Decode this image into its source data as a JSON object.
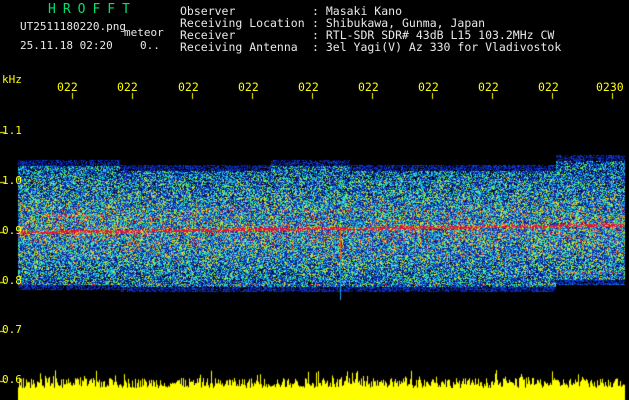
{
  "header": {
    "app_title": "HROFFT",
    "filename": "UT2511180220.png",
    "meteor_label": "meteor",
    "datetime": "25.11.18 02:20",
    "meteor_count": "0..",
    "observer_label": "Observer",
    "observer_value": ": Masaki Kano",
    "location_label": "Receiving Location",
    "location_value": ": Shibukawa, Gunma, Japan",
    "receiver_label": "Receiver",
    "receiver_value": ": RTL-SDR SDR# 43dB L15 103.2MHz CW",
    "antenna_label": "Receiving Antenna",
    "antenna_value": ": 3el Yagi(V) Az 330 for Vladivostok"
  },
  "time_axis": {
    "labels": [
      "022",
      "022",
      "022",
      "022",
      "022",
      "022",
      "022",
      "022",
      "022",
      "0230"
    ],
    "positions": [
      0.09,
      0.185,
      0.282,
      0.38,
      0.48,
      0.575,
      0.67,
      0.768,
      0.865,
      0.96
    ]
  },
  "freq_axis": {
    "unit": "kHz",
    "labels": [
      "1.1",
      "1.0",
      "0.9",
      "0.8",
      "0.7",
      "0.6"
    ]
  },
  "colors": {
    "background": "#000000",
    "title": "#00e070",
    "axis": "#ffff00",
    "text": "#e8e8e8"
  }
}
